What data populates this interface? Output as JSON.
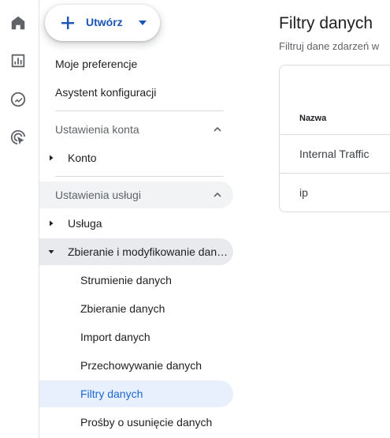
{
  "rail": {
    "icons": [
      "home-icon",
      "reports-icon",
      "explore-icon",
      "advertising-icon"
    ]
  },
  "create_button": {
    "label": "Utwórz"
  },
  "nav": {
    "top_items": [
      "Moje preferencje",
      "Asystent konfiguracji"
    ],
    "account_section": {
      "label": "Ustawienia konta",
      "items": [
        "Konto"
      ]
    },
    "property_section": {
      "label": "Ustawienia usługi",
      "items": [
        "Usługa",
        "Zbieranie i modyfikowanie danych"
      ],
      "sub_items": [
        "Strumienie danych",
        "Zbieranie danych",
        "Import danych",
        "Przechowywanie danych",
        "Filtry danych",
        "Prośby o usunięcie danych"
      ],
      "active_sub_item": "Filtry danych"
    }
  },
  "main": {
    "title": "Filtry danych",
    "subtitle": "Filtruj dane zdarzeń w",
    "table": {
      "columns": [
        "Nazwa"
      ],
      "rows": [
        [
          "Internal Traffic"
        ],
        [
          "ip"
        ]
      ]
    }
  },
  "colors": {
    "accent": "#1a56b7",
    "active_bg": "#e8f0fe",
    "active_text": "#1967d2",
    "section_highlight": "#f1f3f4"
  }
}
